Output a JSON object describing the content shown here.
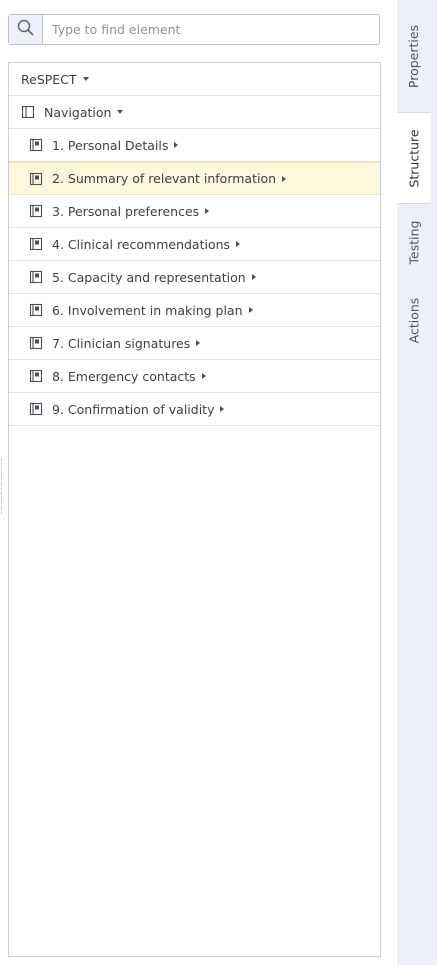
{
  "search": {
    "placeholder": "Type to find element",
    "icon": "search-icon"
  },
  "tree": {
    "root_label": "ReSPECT",
    "nav_label": "Navigation",
    "items": [
      {
        "label": "1. Personal Details"
      },
      {
        "label": "2. Summary of relevant information",
        "selected": true
      },
      {
        "label": "3. Personal preferences"
      },
      {
        "label": "4. Clinical recommendations"
      },
      {
        "label": "5. Capacity and representation"
      },
      {
        "label": "6. Involvement in making plan"
      },
      {
        "label": "7. Clinician signatures"
      },
      {
        "label": "8. Emergency contacts"
      },
      {
        "label": "9. Confirmation of validity"
      }
    ]
  },
  "tabs": [
    {
      "label": "Properties"
    },
    {
      "label": "Structure",
      "active": true
    },
    {
      "label": "Testing"
    },
    {
      "label": "Actions"
    }
  ],
  "colors": {
    "selected_row": "#fdf8dd",
    "tab_bar": "#edf0f8"
  }
}
